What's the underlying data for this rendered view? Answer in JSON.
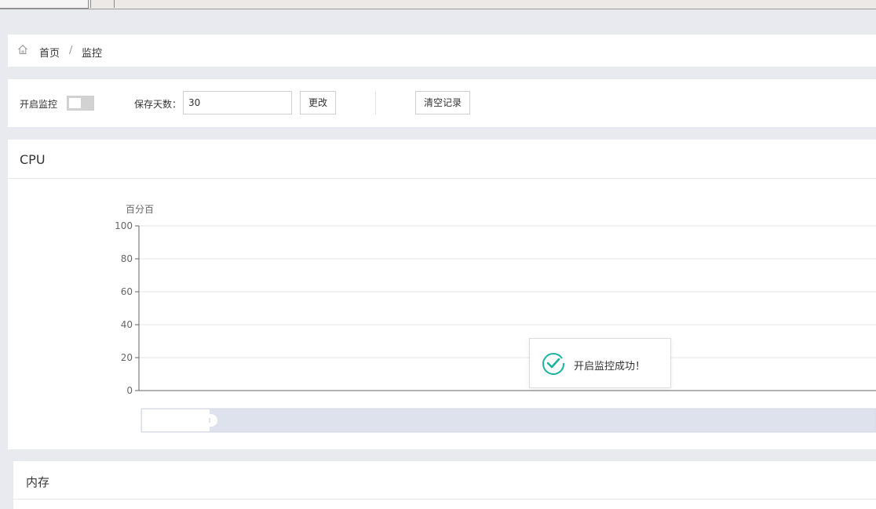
{
  "breadcrumb": {
    "home": "首页",
    "separator": "/",
    "current": "监控"
  },
  "controls": {
    "monitor_label": "开启监控",
    "monitor_enabled": false,
    "days_label": "保存天数：",
    "days_value": "30",
    "change_button": "更改",
    "clear_button": "清空记录"
  },
  "cpu_card": {
    "title": "CPU",
    "chart_data": {
      "type": "line",
      "ylabel": "百分百",
      "ylim": [
        0,
        100
      ],
      "yticks": [
        0,
        20,
        40,
        60,
        80,
        100
      ],
      "series": [],
      "grid": true
    }
  },
  "toast": {
    "message": "开启监控成功！",
    "icon": "check-circle-icon",
    "color": "#1eb3a0"
  },
  "memory_card": {
    "title": "内存"
  },
  "colors": {
    "accent": "#1eb3a0",
    "background": "#e8eaef",
    "grid": "#e6e6e6",
    "slider_track": "#dde2ec"
  }
}
